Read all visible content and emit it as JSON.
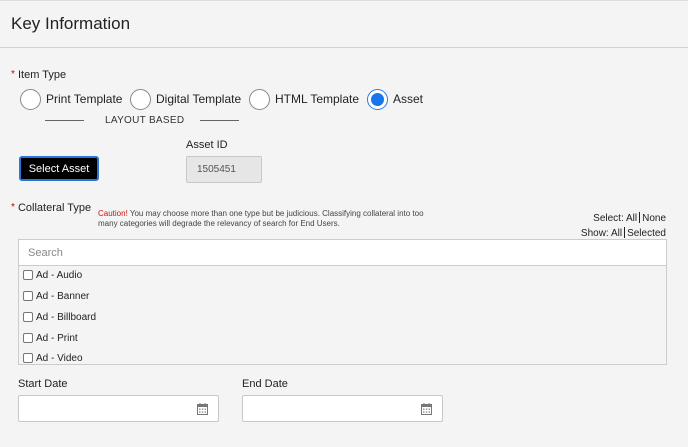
{
  "header": {
    "title": "Key Information"
  },
  "item_type": {
    "label": "Item Type",
    "required_mark": "*",
    "options": [
      {
        "label": "Print Template",
        "checked": false
      },
      {
        "label": "Digital Template",
        "checked": false
      },
      {
        "label": "HTML Template",
        "checked": false
      },
      {
        "label": "Asset",
        "checked": true
      }
    ],
    "group_label": "LAYOUT BASED"
  },
  "select_asset": {
    "label": "Select Asset"
  },
  "asset_id": {
    "label": "Asset ID",
    "value": "1505451"
  },
  "collateral": {
    "label": "Collateral Type",
    "required_mark": "*",
    "caution_prefix": "Caution!",
    "caution_text": " You may choose more than one type but be judicious. Classifying collateral into too many categories will degrade the relevancy of search for End Users.",
    "select_label": "Select:",
    "select_all": "All",
    "select_none": "None",
    "show_label": "Show:",
    "show_all": "All",
    "show_selected": "Selected",
    "search_placeholder": "Search",
    "options": [
      "Ad - Audio",
      "Ad - Banner",
      "Ad - Billboard",
      "Ad - Print",
      "Ad - Video"
    ]
  },
  "start_date": {
    "label": "Start Date",
    "value": ""
  },
  "end_date": {
    "label": "End Date",
    "value": ""
  },
  "colors": {
    "accent": "#1a74ea",
    "caution": "#d01010",
    "button_bg": "#000000"
  },
  "icons": {
    "date": "calendar-icon"
  }
}
